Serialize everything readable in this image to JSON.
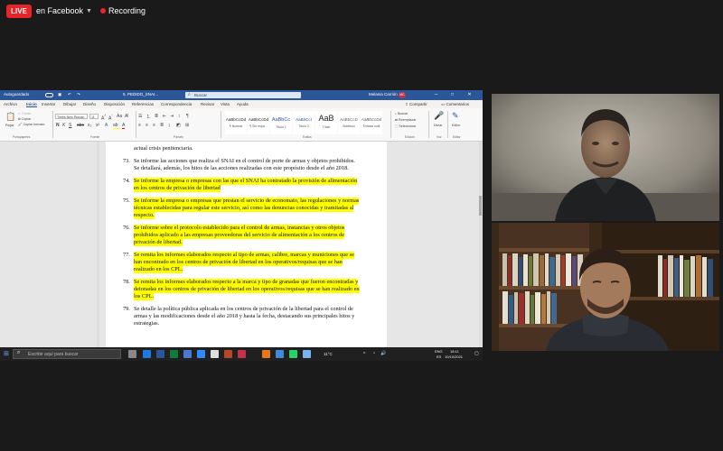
{
  "top_bar": {
    "live_badge": "LIVE",
    "live_destination": "en Facebook",
    "recording_label": "Recording"
  },
  "word": {
    "autosave_label": "Autoguardado",
    "file_name": "5. PEDIDO_SNAI...",
    "search_placeholder": "Buscar",
    "user_name": "Melania Carrión",
    "user_initials": "MC",
    "menu": [
      "Archivo",
      "Inicio",
      "Insertar",
      "Dibujar",
      "Diseño",
      "Disposición",
      "Referencias",
      "Correspondencia",
      "Revisar",
      "Vista",
      "Ayuda"
    ],
    "active_menu": "Inicio",
    "share_label": "Compartir",
    "comments_label": "Comentarios",
    "ribbon": {
      "paste_label": "Pegar",
      "cut_label": "Cortar",
      "copy_label": "Copiar",
      "format_painter_label": "Copiar formato",
      "font_name": "Times New Roman",
      "font_size": "11",
      "styles": [
        {
          "sample": "AaBbCcDd",
          "name": "¶ Normal"
        },
        {
          "sample": "AaBbCcDd",
          "name": "¶ Sin espa..."
        },
        {
          "sample": "AaBbCc",
          "name": "Título 1"
        },
        {
          "sample": "AaBbCcI",
          "name": "Título 2"
        },
        {
          "sample": "AaB",
          "name": "Título"
        },
        {
          "sample": "AaBbCcD",
          "name": "Subtítulo"
        },
        {
          "sample": "AaBbCcDd",
          "name": "Énfasis sutil"
        }
      ],
      "find_label": "Buscar",
      "replace_label": "Reemplazar",
      "select_label": "Seleccionar",
      "dictate_label": "Dictar",
      "editor_label": "Editor",
      "groups": [
        "Portapapeles",
        "Fuente",
        "Párrafo",
        "Estilos",
        "Edición",
        "Voz",
        "Editor"
      ]
    },
    "document_lines": [
      {
        "number": "",
        "text": "actual crisis penitenciaria.",
        "highlight": false
      },
      {
        "number": "73.",
        "text": "Se informe las acciones que realiza el SNAI en el control de porte de armas y objetos prohibidos.",
        "highlight": false
      },
      {
        "number": "",
        "text": "Se detallará, además, los hitos de las acciones realizadas con este propósito desde el año 2018.",
        "highlight": false
      },
      {
        "number": "74.",
        "text": "Se informe la empresa o empresas con las que el SNAI ha contratado la provisión de alimentación",
        "highlight": true
      },
      {
        "number": "",
        "text": "en los centros de privación de libertad",
        "highlight": true
      },
      {
        "number": "75.",
        "text": "Se informe la empresa o empresas que prestan el servicio de economato, las regulaciones y normas",
        "highlight": true
      },
      {
        "number": "",
        "text": "técnicas establecidas para regular este servicio, así como las denuncias conocidas y tramitadas al",
        "highlight": true
      },
      {
        "number": "",
        "text": "respecto.",
        "highlight": true
      },
      {
        "number": "76.",
        "text": "Se informe sobre el protocolo establecido para el control de armas, instancias y otros objetos",
        "highlight": true
      },
      {
        "number": "",
        "text": "prohibidos aplicado a las empresas proveedoras del servicio de alimentación a los centros de",
        "highlight": true
      },
      {
        "number": "",
        "text": "privación de libertad.",
        "highlight": true
      },
      {
        "number": "77.",
        "text": "Se remita los informes elaborados respecto al tipo de armas, calibre, marcas y municiones que se",
        "highlight": true
      },
      {
        "number": "",
        "text": "han encontrado en los centros de privación de libertad en los operativos/requisas que se han",
        "highlight": true
      },
      {
        "number": "",
        "text": "realizado en los CPL.",
        "highlight": true
      },
      {
        "number": "78.",
        "text": "Se remita los informes elaborados respecto a la marca y tipo de granadas que fueron encontradas y",
        "highlight": true
      },
      {
        "number": "",
        "text": "detonadas en los centros de privación de libertad en los operativos/requisas que se han realizado en",
        "highlight": true
      },
      {
        "number": "",
        "text": "los CPL.",
        "highlight": true
      },
      {
        "number": "79.",
        "text": "Se detalle la política pública aplicada en los centros de privación de la libertad para el control de",
        "highlight": false
      },
      {
        "number": "",
        "text": "armas y las modificaciones desde el año 2018 y hasta la fecha, destacando sus principales hitos y",
        "highlight": false
      },
      {
        "number": "",
        "text": "estrategias.",
        "highlight": false
      }
    ],
    "status": {
      "page": "Página 16 de 16",
      "words": "9240 palabras",
      "language": "Español (Ecuador)",
      "focus": "Concentración",
      "zoom": "100%"
    }
  },
  "taskbar": {
    "search_placeholder": "Escribir aquí para buscar",
    "temperature": "11°C",
    "lang_primary": "ENG",
    "lang_secondary": "ES",
    "time": "18:11",
    "date": "10/10/2021"
  },
  "colors": {
    "word_blue": "#2b579a",
    "live_red": "#e8242a",
    "highlight_yellow": "#ffff00"
  }
}
